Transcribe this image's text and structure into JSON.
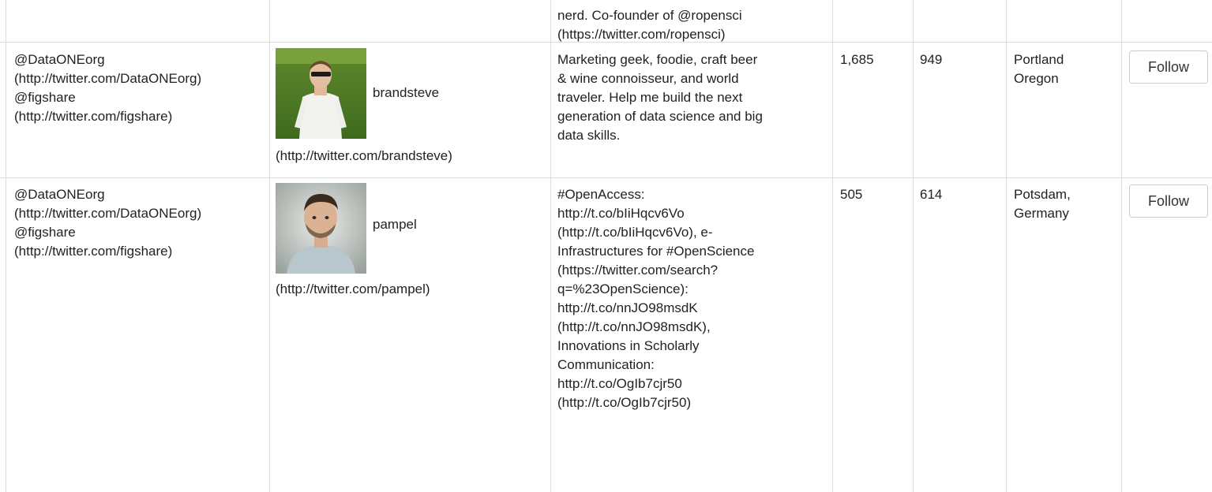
{
  "table": {
    "top_partial_row": {
      "bio_lines": [
        "nerd. Co-founder of @ropensci",
        "(https://twitter.com/ropensci)"
      ]
    },
    "rows": [
      {
        "source_lines": [
          "@DataONEorg",
          "(http://twitter.com/DataONEorg)",
          "@figshare",
          "(http://twitter.com/figshare)"
        ],
        "avatar_icon": "user-photo-icon",
        "username": "brandsteve",
        "profile_link": "(http://twitter.com/brandsteve)",
        "bio_lines": [
          "Marketing geek, foodie, craft beer",
          "& wine connoisseur, and world",
          "traveler. Help me build the next",
          "generation of data science and big",
          "data skills."
        ],
        "followers": "1,685",
        "following": "949",
        "location_lines": [
          "Portland",
          "Oregon"
        ],
        "follow_label": "Follow"
      },
      {
        "source_lines": [
          "@DataONEorg",
          "(http://twitter.com/DataONEorg)",
          "@figshare",
          "(http://twitter.com/figshare)"
        ],
        "avatar_icon": "user-photo-icon",
        "username": "pampel",
        "profile_link": "(http://twitter.com/pampel)",
        "bio_lines": [
          "#OpenAccess:",
          "http://t.co/bIiHqcv6Vo",
          "(http://t.co/bIiHqcv6Vo), e-",
          "Infrastructures for #OpenScience",
          "(https://twitter.com/search?",
          "q=%23OpenScience):",
          "http://t.co/nnJO98msdK",
          "(http://t.co/nnJO98msdK),",
          "Innovations in Scholarly",
          "Communication:",
          "http://t.co/OgIb7cjr50",
          "(http://t.co/OgIb7cjr50)"
        ],
        "followers": "505",
        "following": "614",
        "location_lines": [
          "Potsdam,",
          "Germany"
        ],
        "follow_label": "Follow"
      }
    ]
  },
  "colors": {
    "border": "#dddddd",
    "text": "#222222"
  }
}
